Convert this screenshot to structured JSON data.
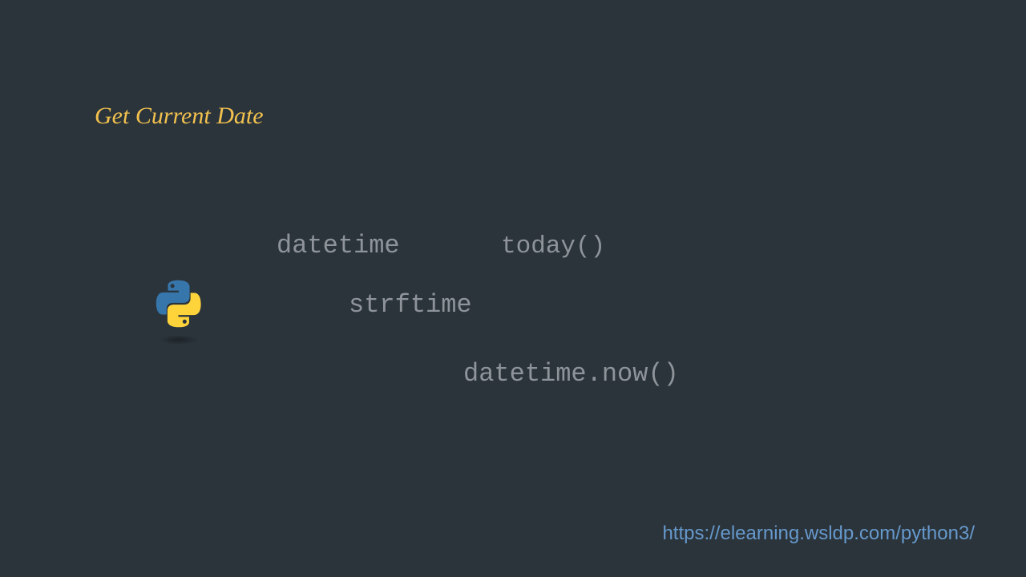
{
  "title": "Get Current Date",
  "keywords": {
    "datetime": "datetime",
    "today": "today()",
    "strftime": "strftime",
    "now": "datetime.now()"
  },
  "url": "https://elearning.wsldp.com/python3/"
}
